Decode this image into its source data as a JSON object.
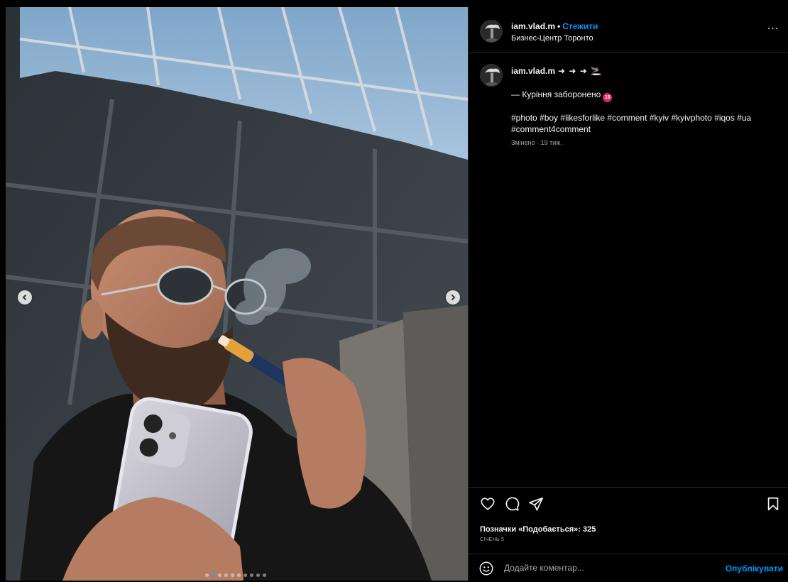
{
  "post": {
    "username": "iam.vlad.m",
    "separator": "•",
    "follow_label": "Стежити",
    "location": "Бизнес-Центр Торонто",
    "more_label": "...",
    "caption": {
      "username": "iam.vlad.m",
      "emoji_trail": "➜ ➜ ➜ 🚬",
      "line1": "— Куріння заборонено",
      "line1_badge": "18",
      "hashtags": "#photo #boy #likesforlike #comment #kyiv #kyivphoto #iqos #ua #comment4comment",
      "edited": "Змінено · 19 тиж."
    },
    "likes_text": "Позначки «Подобається»: 325",
    "date": "СІЧЕНЬ 5",
    "comment_placeholder": "Додайте коментар...",
    "post_button": "Опублікувати",
    "carousel": {
      "total": 10,
      "active_index": 1
    }
  },
  "icons": {
    "like": "heart-icon",
    "comment": "comment-icon",
    "share": "paper-plane-icon",
    "save": "bookmark-icon",
    "emoji": "smiley-icon",
    "prev": "chevron-left-icon",
    "next": "chevron-right-icon",
    "more": "more-icon"
  },
  "colors": {
    "background": "#000000",
    "text": "#f5f5f5",
    "link_blue": "#0095f6",
    "muted": "#a8a8a8",
    "divider": "#262626",
    "active_dot": "#3897f0"
  }
}
